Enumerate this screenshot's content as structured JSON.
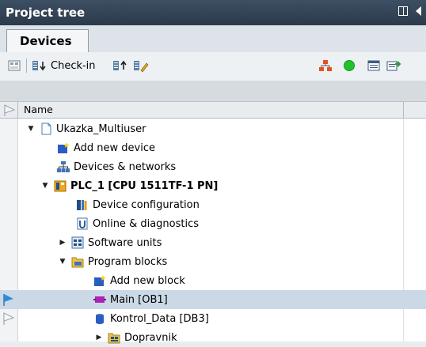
{
  "panel": {
    "title": "Project tree"
  },
  "tabs": [
    {
      "label": "Devices"
    }
  ],
  "toolbar": {
    "checkin_label": "Check-in"
  },
  "columns": {
    "name": "Name"
  },
  "tree": [
    {
      "label": "Ukazka_Multiuser",
      "icon": "project-icon",
      "expander": "expanded"
    },
    {
      "label": "Add new device",
      "icon": "add-device-icon",
      "expander": "none"
    },
    {
      "label": "Devices & networks",
      "icon": "network-icon",
      "expander": "none"
    },
    {
      "label": "PLC_1 [CPU 1511TF-1 PN]",
      "icon": "plc-icon",
      "expander": "expanded"
    },
    {
      "label": "Device configuration",
      "icon": "device-config-icon",
      "expander": "none"
    },
    {
      "label": "Online & diagnostics",
      "icon": "diagnostics-icon",
      "expander": "none"
    },
    {
      "label": "Software units",
      "icon": "software-units-icon",
      "expander": "collapsed"
    },
    {
      "label": "Program blocks",
      "icon": "folder-icon",
      "expander": "expanded"
    },
    {
      "label": "Add new block",
      "icon": "add-block-icon",
      "expander": "none"
    },
    {
      "label": "Main [OB1]",
      "icon": "ob-block-icon",
      "expander": "none"
    },
    {
      "label": "Kontrol_Data [DB3]",
      "icon": "db-block-icon",
      "expander": "none"
    },
    {
      "label": "Dopravnik",
      "icon": "group-folder-icon",
      "expander": "collapsed"
    }
  ],
  "colors": {
    "accent": "#2b3a4a",
    "selection": "#cbd9e6",
    "status_online": "#22c12a"
  }
}
